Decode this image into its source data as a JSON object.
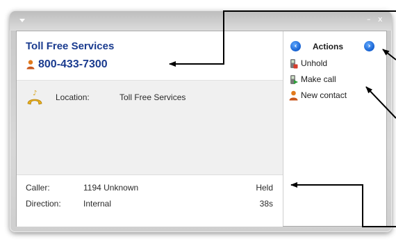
{
  "window": {
    "menu_icon": "dropdown-arrow-icon",
    "minimize_label": "–",
    "close_label": "x"
  },
  "call": {
    "name": "Toll Free Services",
    "number": "800-433-7300",
    "location_label": "Location:",
    "location_value": "Toll Free Services",
    "caller_label": "Caller:",
    "caller_value": "1194  Unknown",
    "status": "Held",
    "direction_label": "Direction:",
    "direction_value": "Internal",
    "duration": "38s"
  },
  "actions": {
    "title": "Actions",
    "items": [
      {
        "label": "Unhold",
        "icon": "unhold-phone-icon"
      },
      {
        "label": "Make call",
        "icon": "make-call-icon"
      },
      {
        "label": "New contact",
        "icon": "contact-person-icon"
      }
    ]
  },
  "colors": {
    "accent": "#1a3b8f",
    "nav_blue": "#1560d0",
    "person_orange": "#e27a1c"
  }
}
